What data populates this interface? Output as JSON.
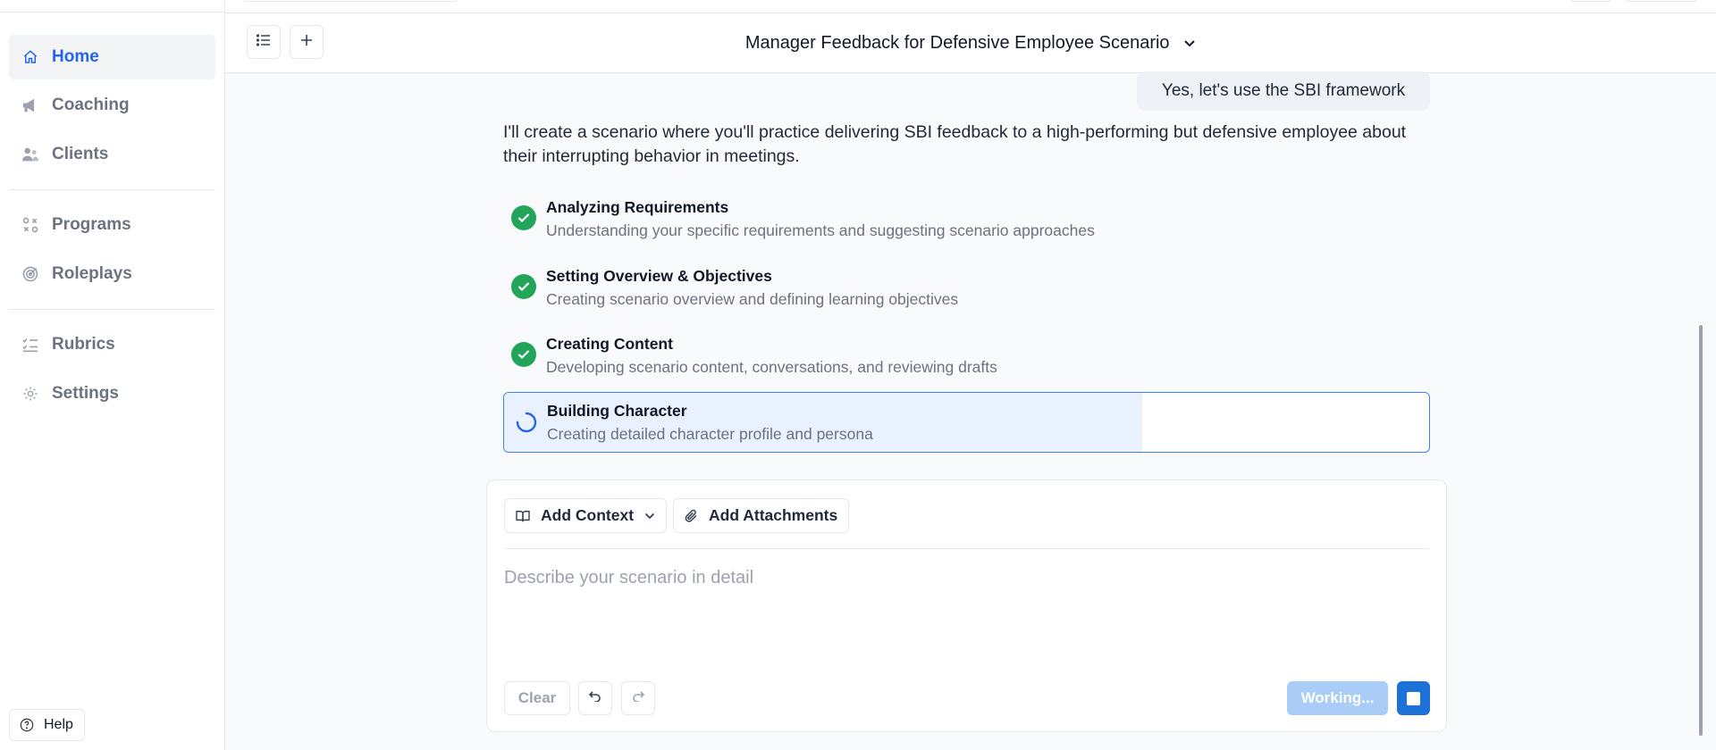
{
  "sidebar": {
    "items": [
      {
        "label": "Home",
        "icon": "home-icon",
        "active": true
      },
      {
        "label": "Coaching",
        "icon": "megaphone-icon"
      },
      {
        "label": "Clients",
        "icon": "users-icon"
      },
      {
        "label": "Programs",
        "icon": "programs-icon"
      },
      {
        "label": "Roleplays",
        "icon": "target-icon"
      },
      {
        "label": "Rubrics",
        "icon": "checklist-icon"
      },
      {
        "label": "Settings",
        "icon": "gear-icon"
      }
    ],
    "help_label": "Help"
  },
  "header": {
    "title": "Manager Feedback for Defensive Employee Scenario"
  },
  "chat": {
    "user_message": "Yes, let's use the SBI framework",
    "assistant_message": "I'll create a scenario where you'll practice delivering SBI feedback to a high-performing but defensive employee about their interrupting behavior in meetings.",
    "steps": [
      {
        "title": "Analyzing Requirements",
        "description": "Understanding your specific requirements and suggesting scenario approaches",
        "status": "done"
      },
      {
        "title": "Setting Overview & Objectives",
        "description": "Creating scenario overview and defining learning objectives",
        "status": "done"
      },
      {
        "title": "Creating Content",
        "description": "Developing scenario content, conversations, and reviewing drafts",
        "status": "done"
      },
      {
        "title": "Building Character",
        "description": "Creating detailed character profile and persona",
        "status": "in-progress",
        "progress": 0.69
      }
    ]
  },
  "composer": {
    "add_context_label": "Add Context",
    "add_attachments_label": "Add Attachments",
    "placeholder": "Describe your scenario in detail",
    "value": "",
    "clear_label": "Clear",
    "working_label": "Working..."
  },
  "colors": {
    "accent": "#2563eb",
    "success": "#22a55a",
    "working": "#a9cdf7",
    "stop": "#1d72d8"
  }
}
